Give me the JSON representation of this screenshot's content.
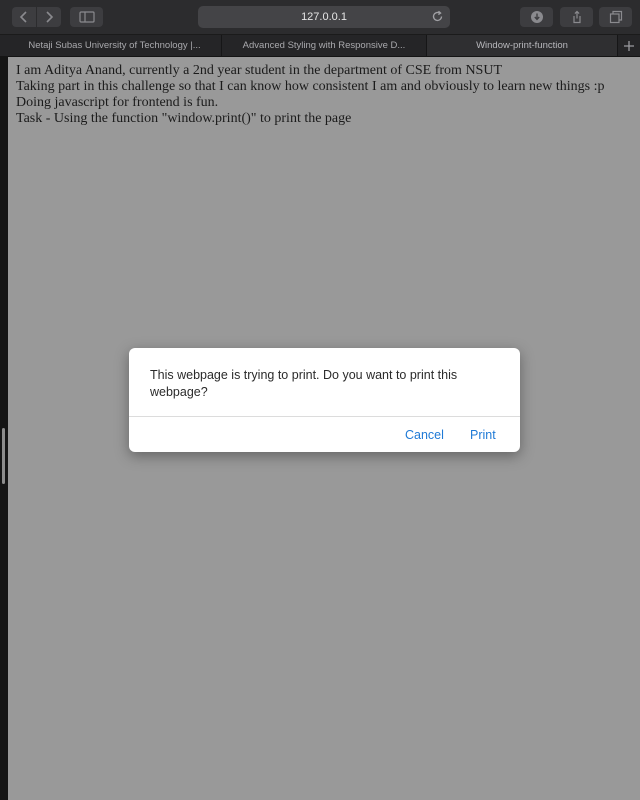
{
  "browser": {
    "address": "127.0.0.1",
    "tabs": [
      {
        "label": "Netaji Subas University of Technology |..."
      },
      {
        "label": "Advanced Styling with Responsive D..."
      },
      {
        "label": "Window-print-function"
      }
    ]
  },
  "page": {
    "lines": [
      "I am Aditya Anand, currently a 2nd year student in the department of CSE from NSUT",
      "Taking part in this challenge so that I can know how consistent I am and obviously to learn new things :p",
      "Doing javascript for frontend is fun.",
      "Task - Using the function \"window.print()\" to print the page"
    ]
  },
  "dialog": {
    "message": "This webpage is trying to print. Do you want to print this webpage?",
    "cancel_label": "Cancel",
    "print_label": "Print"
  },
  "colors": {
    "page_background": "#999999",
    "dialog_button": "#1f7ad6"
  },
  "icons": [
    "back-icon",
    "forward-icon",
    "sidebar-icon",
    "reload-icon",
    "download-icon",
    "share-icon",
    "tabs-icon",
    "plus-icon"
  ]
}
